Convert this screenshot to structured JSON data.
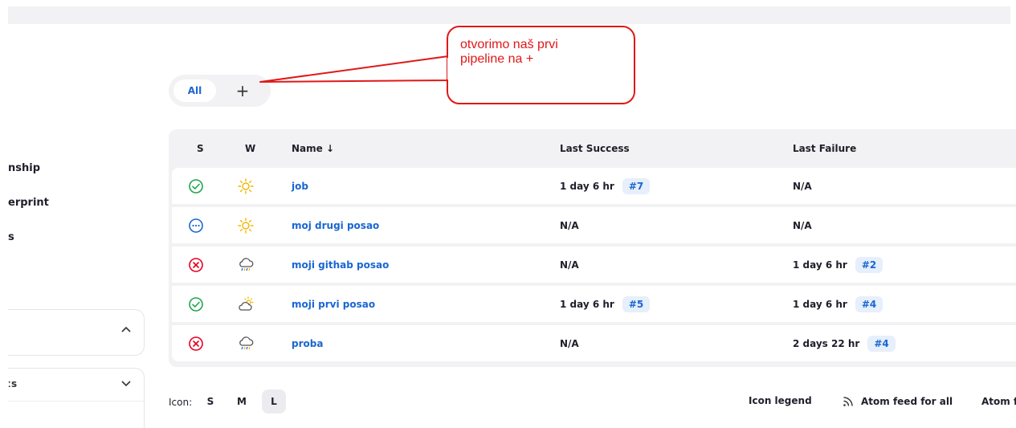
{
  "sidebar": {
    "links": [
      "nship",
      "erprint",
      "s"
    ],
    "panel2_fragment": "ːs"
  },
  "tabs": {
    "all_label": "All",
    "add_label": "+"
  },
  "callout": {
    "line1": "otvorimo naš prvi",
    "line2": "pipeline na +"
  },
  "table": {
    "headers": {
      "status": "S",
      "weather": "W",
      "name": "Name ↓",
      "last_success": "Last Success",
      "last_failure": "Last Failure"
    },
    "rows": [
      {
        "status": "success",
        "weather": "sunny",
        "name": "job",
        "last_success": "1 day 6 hr",
        "last_success_build": "#7",
        "last_failure": "N/A",
        "last_failure_build": ""
      },
      {
        "status": "pending",
        "weather": "sunny",
        "name": "moj drugi posao",
        "last_success": "N/A",
        "last_success_build": "",
        "last_failure": "N/A",
        "last_failure_build": ""
      },
      {
        "status": "failed",
        "weather": "storm",
        "name": "moji githab posao",
        "last_success": "N/A",
        "last_success_build": "",
        "last_failure": "1 day 6 hr",
        "last_failure_build": "#2"
      },
      {
        "status": "success",
        "weather": "partly-cloudy",
        "name": "moji prvi posao",
        "last_success": "1 day 6 hr",
        "last_success_build": "#5",
        "last_failure": "1 day 6 hr",
        "last_failure_build": "#4"
      },
      {
        "status": "failed",
        "weather": "storm",
        "name": "proba",
        "last_success": "N/A",
        "last_success_build": "",
        "last_failure": "2 days 22 hr",
        "last_failure_build": "#4"
      }
    ]
  },
  "footer": {
    "icon_label": "Icon:",
    "sizes": [
      "S",
      "M",
      "L"
    ],
    "active_size": "L",
    "icon_legend": "Icon legend",
    "atom_all": "Atom feed for all",
    "atom_failures": "Atom feed for failures"
  },
  "colors": {
    "link": "#1a66d2",
    "success": "#1ea64b",
    "failed": "#e6001f",
    "pending": "#1a66d2",
    "sun": "#f4b400",
    "annotation": "#e01818"
  }
}
